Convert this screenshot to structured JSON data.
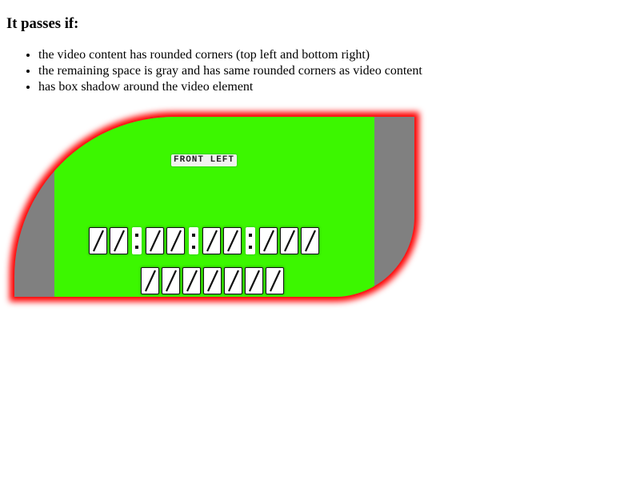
{
  "heading": "It passes if:",
  "criteria": [
    "the video content has rounded corners (top left and bottom right)",
    "the remaining space is gray and has same rounded corners as video content",
    "has box shadow around the video element"
  ],
  "video": {
    "label": "FRONT LEFT",
    "timecode_digit_groups": 4,
    "digits_per_group": [
      2,
      2,
      2,
      3
    ],
    "counter_digits": 7,
    "colors": {
      "content": "#3cf700",
      "letterbox": "#808080",
      "shadow": "#ff0000"
    }
  }
}
